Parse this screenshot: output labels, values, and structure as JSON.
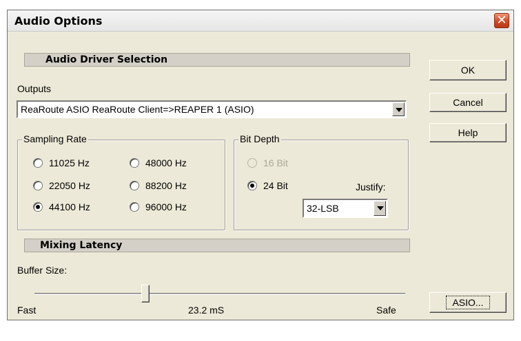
{
  "window": {
    "title": "Audio Options",
    "close_glyph": "✕"
  },
  "driver_section": {
    "label": "Audio Driver Selection"
  },
  "outputs": {
    "label": "Outputs",
    "value": "ReaRoute ASIO ReaRoute Client=>REAPER 1 (ASIO)"
  },
  "sampling_rate": {
    "label": "Sampling Rate",
    "options": [
      {
        "label": "11025 Hz",
        "selected": false
      },
      {
        "label": "48000 Hz",
        "selected": false
      },
      {
        "label": "22050 Hz",
        "selected": false
      },
      {
        "label": "88200 Hz",
        "selected": false
      },
      {
        "label": "44100 Hz",
        "selected": true
      },
      {
        "label": "96000 Hz",
        "selected": false
      }
    ]
  },
  "bit_depth": {
    "label": "Bit Depth",
    "options": [
      {
        "label": "16 Bit",
        "selected": false,
        "disabled": true
      },
      {
        "label": "24 Bit",
        "selected": true,
        "disabled": false
      }
    ],
    "justify_label": "Justify:",
    "justify_value": "32-LSB"
  },
  "mixing_section": {
    "label": "Mixing Latency"
  },
  "buffer": {
    "label": "Buffer Size:",
    "min_label": "Fast",
    "max_label": "Safe",
    "value_label": "23.2 mS",
    "slider_fraction": 0.3
  },
  "buttons": {
    "ok": "OK",
    "cancel": "Cancel",
    "help": "Help",
    "asio": "ASIO..."
  },
  "colors": {
    "dialog_bg": "#ece9d8",
    "close_red": "#cf4b25",
    "section_bar": "#d4d0c8"
  }
}
